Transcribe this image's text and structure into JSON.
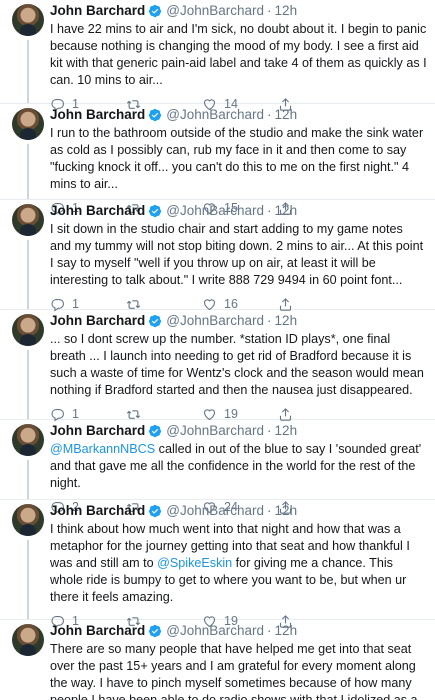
{
  "author": {
    "name": "John Barchard",
    "handle": "@JohnBarchard",
    "separator": "·",
    "time": "12h"
  },
  "tweets": [
    {
      "text": "I have 22 mins to air and I'm sick, no doubt about it. I begin to panic because nothing is changing the mood of my body. I see a first aid kit with that generic pain-aid label and take 4 of them as quickly as I can. 10 mins to air...",
      "replies": "1",
      "retweets": "",
      "likes": "14"
    },
    {
      "text": "I run to the bathroom outside of the studio and make the sink water as cold as I possibly can, rub my face in it and then come to say \"fucking knock it off... you can't do this to me on the first night.\" 4 mins to air...",
      "replies": "1",
      "retweets": "",
      "likes": "15"
    },
    {
      "text": "I sit down in the studio chair and start adding to my game notes and my tummy will not stop biting down. 2 mins to air... At this point I say to myself \"well if you throw up on air, at least it will be interesting to talk about.\" I write 888 729 9494 in 60 point font...",
      "replies": "1",
      "retweets": "",
      "likes": "16"
    },
    {
      "text": "... so I dont screw up the number. *station ID plays*, one final breath ... I launch into needing to get rid of Bradford because it is such a waste of time for Wentz's clock and the season would mean nothing if Bradford started and then the nausea just disappeared.",
      "replies": "1",
      "retweets": "",
      "likes": "19"
    },
    {
      "mention_before": "@MBarkannNBCS",
      "text": " called in out of the blue to say I 'sounded great' and that gave me all the confidence in the world for the rest of the night.",
      "replies": "2",
      "retweets": "",
      "likes": "24"
    },
    {
      "text": "I think about how much went into that night and how that was a metaphor for the journey getting into that seat and how thankful I was and still am to ",
      "mention_mid": "@SpikeEskin",
      "text_after": " for giving me a chance. This whole ride is bumpy to get to where you want to be, but when ur there it feels amazing.",
      "replies": "1",
      "retweets": "",
      "likes": "19"
    },
    {
      "text": "There are so many people that have helped me get into that seat over the past 15+ years and I am grateful for every moment along the way. I have to pinch myself sometimes because of how many people I have been able to do radio shows with that I idolized as a kid.",
      "replies": "",
      "retweets": "",
      "likes": ""
    }
  ],
  "icons": {
    "reply": "reply-icon",
    "retweet": "retweet-icon",
    "like": "heart-icon",
    "share": "share-icon",
    "verified": "verified-badge-icon"
  },
  "colors": {
    "text": "#14171a",
    "secondary": "#657786",
    "link": "#1b95e0",
    "verified": "#1da1f2",
    "divider": "#e6ecf0"
  }
}
